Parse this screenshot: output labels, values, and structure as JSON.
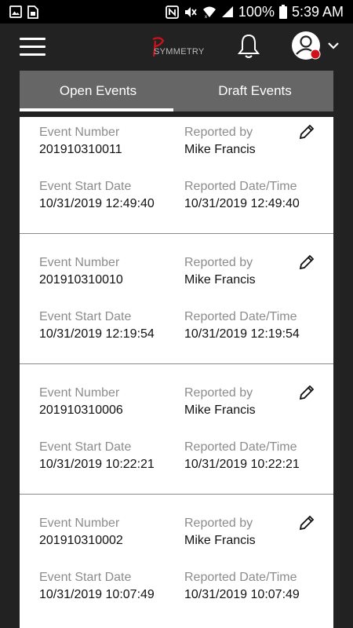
{
  "status_bar": {
    "battery": "100%",
    "time": "5:39 AM",
    "icons_left": [
      "gallery-icon",
      "sim-icon"
    ],
    "icons_right": [
      "nfc-icon",
      "mute-icon",
      "wifi-icon",
      "signal-icon",
      "battery-icon"
    ]
  },
  "header": {
    "logo_text": "SYMMETRY",
    "menu_icon": "hamburger-menu-icon",
    "notification_icon": "bell-icon",
    "profile_icon": "user-avatar-icon",
    "dropdown_icon": "chevron-down-icon",
    "accent_color": "#d0101a"
  },
  "tabs": [
    {
      "label": "Open Events",
      "active": true
    },
    {
      "label": "Draft Events",
      "active": false
    }
  ],
  "labels": {
    "event_number": "Event Number",
    "reported_by": "Reported by",
    "event_start_date": "Event Start Date",
    "reported_datetime": "Reported Date/Time"
  },
  "events": [
    {
      "event_number": "201910310011",
      "reported_by": "Mike Francis",
      "event_start_date": "10/31/2019 12:49:40",
      "reported_datetime": "10/31/2019 12:49:40"
    },
    {
      "event_number": "201910310010",
      "reported_by": "Mike Francis",
      "event_start_date": "10/31/2019 12:19:54",
      "reported_datetime": "10/31/2019 12:19:54"
    },
    {
      "event_number": "201910310006",
      "reported_by": "Mike Francis",
      "event_start_date": "10/31/2019 10:22:21",
      "reported_datetime": "10/31/2019 10:22:21"
    },
    {
      "event_number": "201910310002",
      "reported_by": "Mike Francis",
      "event_start_date": "10/31/2019 10:07:49",
      "reported_datetime": "10/31/2019 10:07:49"
    }
  ]
}
